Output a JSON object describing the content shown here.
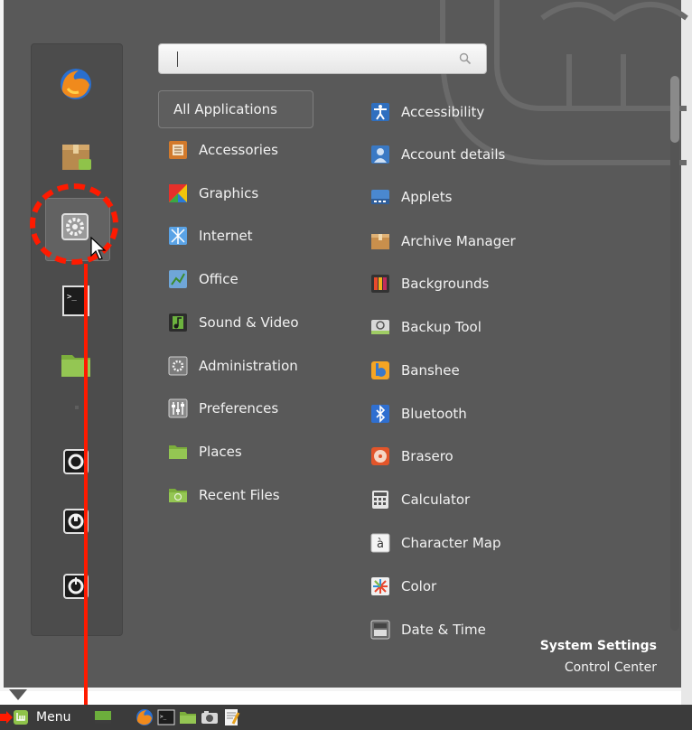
{
  "search": {
    "value": "",
    "placeholder": ""
  },
  "favorites": [
    {
      "name": "firefox",
      "icon": "firefox-icon"
    },
    {
      "name": "software-manager",
      "icon": "package-icon"
    },
    {
      "name": "system-settings",
      "icon": "settings-icon"
    },
    {
      "name": "terminal",
      "icon": "terminal-icon"
    },
    {
      "name": "files",
      "icon": "folder-icon"
    },
    {
      "name": "lock-screen",
      "icon": "lock-icon"
    },
    {
      "name": "logout",
      "icon": "logout-icon"
    },
    {
      "name": "shutdown",
      "icon": "power-icon"
    }
  ],
  "categories": [
    {
      "label": "All Applications",
      "icon": ""
    },
    {
      "label": "Accessories",
      "icon": "accessories-icon"
    },
    {
      "label": "Graphics",
      "icon": "graphics-icon"
    },
    {
      "label": "Internet",
      "icon": "internet-icon"
    },
    {
      "label": "Office",
      "icon": "office-icon"
    },
    {
      "label": "Sound & Video",
      "icon": "sound-video-icon"
    },
    {
      "label": "Administration",
      "icon": "administration-icon"
    },
    {
      "label": "Preferences",
      "icon": "preferences-icon"
    },
    {
      "label": "Places",
      "icon": "places-icon"
    },
    {
      "label": "Recent Files",
      "icon": "recent-files-icon"
    }
  ],
  "applications": [
    {
      "label": "Accessibility",
      "icon": "accessibility-icon"
    },
    {
      "label": "Account details",
      "icon": "account-icon"
    },
    {
      "label": "Applets",
      "icon": "applets-icon"
    },
    {
      "label": "Archive Manager",
      "icon": "archive-icon"
    },
    {
      "label": "Backgrounds",
      "icon": "backgrounds-icon"
    },
    {
      "label": "Backup Tool",
      "icon": "backup-icon"
    },
    {
      "label": "Banshee",
      "icon": "banshee-icon"
    },
    {
      "label": "Bluetooth",
      "icon": "bluetooth-icon"
    },
    {
      "label": "Brasero",
      "icon": "brasero-icon"
    },
    {
      "label": "Calculator",
      "icon": "calculator-icon"
    },
    {
      "label": "Character Map",
      "icon": "character-map-icon"
    },
    {
      "label": "Color",
      "icon": "color-icon"
    },
    {
      "label": "Date & Time",
      "icon": "date-time-icon"
    }
  ],
  "character_map_glyph": "à",
  "description": {
    "title": "System Settings",
    "subtitle": "Control Center"
  },
  "taskbar": {
    "menu_label": "Menu"
  },
  "colors": {
    "panel": "#595959",
    "annotation": "#ff1a00",
    "mint": "#8fc34a"
  }
}
